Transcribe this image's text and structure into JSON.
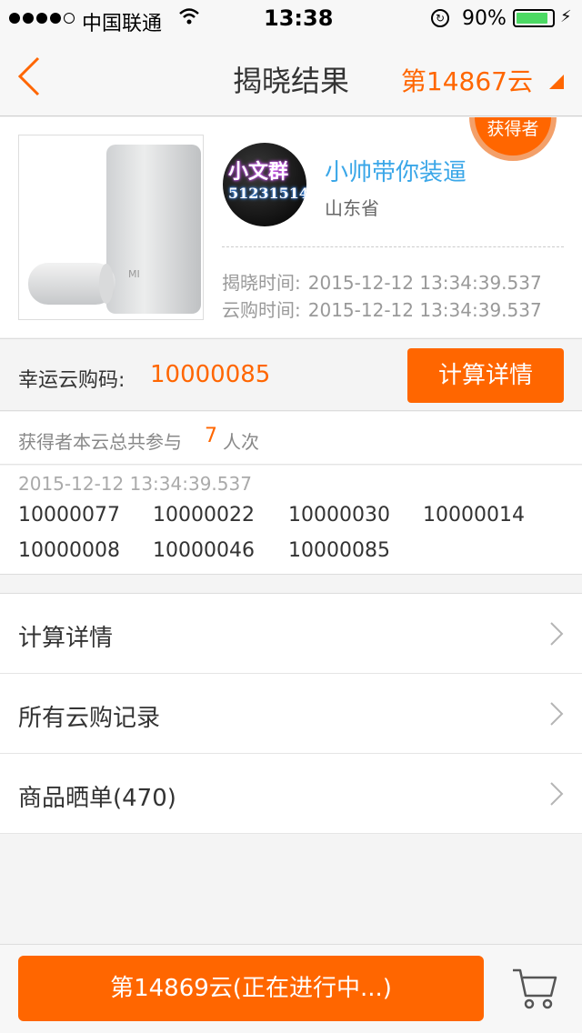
{
  "status": {
    "carrier": "中国联通",
    "time": "13:38",
    "battery": "90%"
  },
  "nav": {
    "title": "揭晓结果",
    "period": "第14867云"
  },
  "winner": {
    "badge": "获得者",
    "avatar_line1": "小文群",
    "avatar_line2": "51231514",
    "name": "小帅带你装逼",
    "province": "山东省",
    "reveal_label": "揭晓时间:",
    "reveal_time": "2015-12-12 13:34:39.537",
    "buy_label": "云购时间:",
    "buy_time": "2015-12-12 13:34:39.537"
  },
  "lucky": {
    "label": "幸运云购码:",
    "code": "10000085",
    "button": "计算详情"
  },
  "participation": {
    "prefix": "获得者本云总共参与",
    "count": "7",
    "suffix": "人次"
  },
  "codes": {
    "timestamp": "2015-12-12 13:34:39.537",
    "items": [
      "10000077",
      "10000022",
      "10000030",
      "10000014",
      "10000008",
      "10000046",
      "10000085"
    ]
  },
  "menu": [
    {
      "label": "计算详情"
    },
    {
      "label": "所有云购记录"
    },
    {
      "label": "商品晒单(470)"
    }
  ],
  "bottom": {
    "button": "第14869云(正在进行中...)"
  },
  "colors": {
    "accent": "#ff6600",
    "link": "#3ba7e8"
  }
}
